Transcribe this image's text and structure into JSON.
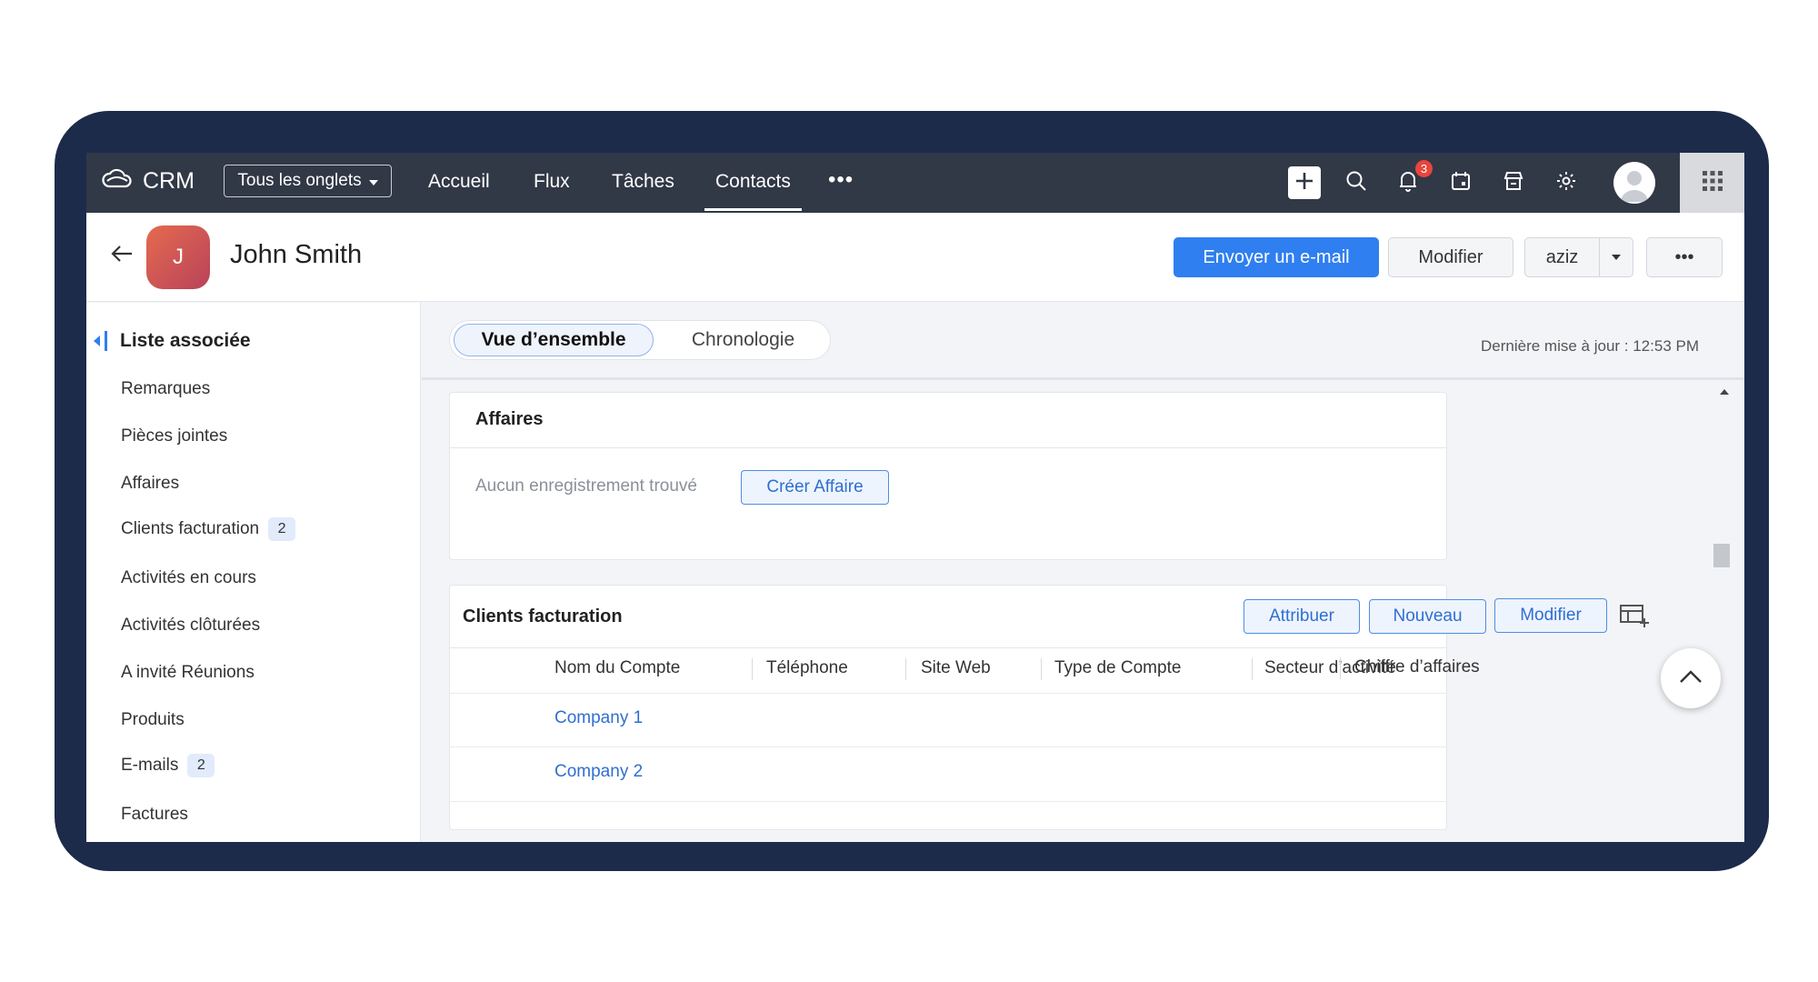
{
  "app": {
    "name": "CRM"
  },
  "nav": {
    "tabs_dropdown": "Tous les onglets",
    "items": [
      "Accueil",
      "Flux",
      "Tâches",
      "Contacts"
    ],
    "active": "Contacts",
    "more": "•••",
    "notification_count": "3"
  },
  "record": {
    "avatar_letter": "J",
    "name": "John Smith",
    "actions": {
      "email": "Envoyer un e-mail",
      "edit": "Modifier",
      "user": "aziz",
      "more": "•••"
    }
  },
  "sidebar": {
    "title": "Liste associée",
    "items": [
      {
        "label": "Remarques",
        "count": ""
      },
      {
        "label": "Pièces jointes",
        "count": ""
      },
      {
        "label": "Affaires",
        "count": ""
      },
      {
        "label": "Clients facturation",
        "count": "2"
      },
      {
        "label": "Activités en cours",
        "count": ""
      },
      {
        "label": "Activités clôturées",
        "count": ""
      },
      {
        "label": "A invité Réunions",
        "count": ""
      },
      {
        "label": "Produits",
        "count": ""
      },
      {
        "label": "E-mails",
        "count": "2"
      },
      {
        "label": "Factures",
        "count": ""
      }
    ]
  },
  "views": {
    "overview": "Vue d’ensemble",
    "timeline": "Chronologie",
    "last_updated": "Dernière mise à jour : 12:53 PM"
  },
  "deals": {
    "title": "Affaires",
    "empty": "Aucun enregistrement trouvé",
    "create": "Créer Affaire"
  },
  "billing": {
    "title": "Clients facturation",
    "buttons": {
      "assign": "Attribuer",
      "new": "Nouveau",
      "edit": "Modifier"
    },
    "columns": [
      "Nom du Compte",
      "Téléphone",
      "Site Web",
      "Type de Compte",
      "Secteur d’activité",
      "Chiffre d’affaires"
    ],
    "rows": [
      {
        "account": "Company 1"
      },
      {
        "account": "Company 2"
      }
    ]
  },
  "colors": {
    "accent": "#2f7ff0",
    "topbar": "#313846",
    "frame": "#1c2b4a",
    "badge": "#e8453c"
  }
}
